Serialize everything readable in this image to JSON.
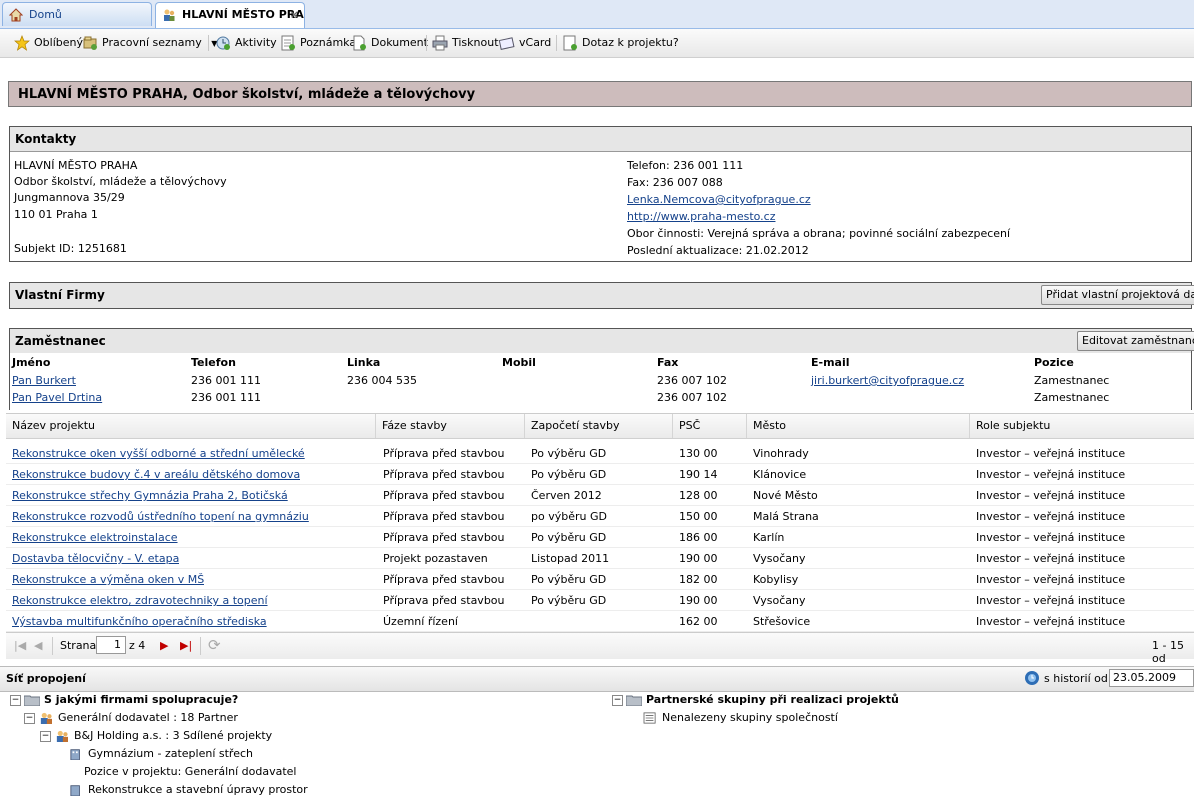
{
  "tabs": [
    {
      "label": "Domů",
      "icon": "home-icon"
    },
    {
      "label": "HLAVNÍ MĚSTO PRA",
      "icon": "people-icon",
      "close": "×"
    }
  ],
  "toolbar": {
    "oblibeny": "Oblíbený",
    "pracovni": "Pracovní seznamy",
    "aktivity": "Aktivity",
    "poznamka": "Poznámka",
    "dokument": "Dokument",
    "tisknout": "Tisknout",
    "vcard": "vCard",
    "dotaz": "Dotaz k projektu?"
  },
  "title": "HLAVNÍ MĚSTO PRAHA, Odbor školství, mládeže a tělovýchovy",
  "kontakty": {
    "header": "Kontakty",
    "name": "HLAVNÍ MĚSTO PRAHA",
    "dept": "Odbor školství, mládeže a tělovýchovy",
    "street": "Jungmannova 35/29",
    "city": "110 01 Praha 1",
    "subject_id": "Subjekt ID: 1251681",
    "phone": "Telefon: 236 001 111",
    "fax": "Fax: 236 007 088",
    "email": "Lenka.Nemcova@cityofprague.cz",
    "web": "http://www.praha-mesto.cz",
    "obor": "Obor činnosti: Verejná správa a obrana; povinné sociální zabezpecení",
    "aktualizace": "Poslední aktualizace: 21.02.2012"
  },
  "firmy": {
    "header": "Vlastní Firmy",
    "button": "Přidat vlastní projektová data"
  },
  "zamestnanec": {
    "header": "Zaměstnanec",
    "button": "Editovat zaměstnance",
    "columns": [
      "Jméno",
      "Telefon",
      "Linka",
      "Mobil",
      "Fax",
      "E-mail",
      "Pozice"
    ],
    "rows": [
      {
        "name": "Pan Burkert",
        "phone": "236 001 111",
        "linka": "236 004 535",
        "mobil": "",
        "fax": "236 007 102",
        "email": "jiri.burkert@cityofprague.cz",
        "pozice": "Zamestnanec"
      },
      {
        "name": "Pan Pavel Drtina",
        "phone": "236 001 111",
        "linka": "",
        "mobil": "",
        "fax": "236 007 102",
        "email": "",
        "pozice": "Zamestnanec"
      }
    ]
  },
  "projects": {
    "columns": [
      "Název projektu",
      "Fáze stavby",
      "Započetí stavby",
      "PSČ",
      "Město",
      "Role subjektu"
    ],
    "rows": [
      {
        "name": "Rekonstrukce oken vyšší odborné a střední umělecké",
        "faze": "Příprava před stavbou",
        "zapoceti": "Po výběru GD",
        "psc": "130 00",
        "mesto": "Vinohrady",
        "role": "Investor – veřejná instituce"
      },
      {
        "name": "Rekonstrukce budovy č.4 v areálu dětského domova",
        "faze": "Příprava před stavbou",
        "zapoceti": "Po výběru GD",
        "psc": "190 14",
        "mesto": "Klánovice",
        "role": "Investor – veřejná instituce"
      },
      {
        "name": "Rekonstrukce střechy Gymnázia Praha 2, Botičská",
        "faze": "Příprava před stavbou",
        "zapoceti": "Červen 2012",
        "psc": "128 00",
        "mesto": "Nové Město",
        "role": "Investor – veřejná instituce"
      },
      {
        "name": "Rekonstrukce rozvodů ústředního topení na gymnáziu",
        "faze": "Příprava před stavbou",
        "zapoceti": "po výběru GD",
        "psc": "150 00",
        "mesto": "Malá Strana",
        "role": "Investor – veřejná instituce"
      },
      {
        "name": "Rekonstrukce elektroinstalace",
        "faze": "Příprava před stavbou",
        "zapoceti": "Po výběru GD",
        "psc": "186 00",
        "mesto": "Karlín",
        "role": "Investor – veřejná instituce"
      },
      {
        "name": "Dostavba tělocvičny - V. etapa",
        "faze": "Projekt pozastaven",
        "zapoceti": "Listopad 2011",
        "psc": "190 00",
        "mesto": "Vysočany",
        "role": "Investor – veřejná instituce"
      },
      {
        "name": "Rekonstrukce a výměna oken v MŠ",
        "faze": "Příprava před stavbou",
        "zapoceti": "Po výběru GD",
        "psc": "182 00",
        "mesto": "Kobylisy",
        "role": "Investor – veřejná instituce"
      },
      {
        "name": "Rekonstrukce elektro, zdravotechniky a topení",
        "faze": "Příprava před stavbou",
        "zapoceti": "Po výběru GD",
        "psc": "190 00",
        "mesto": "Vysočany",
        "role": "Investor – veřejná instituce"
      },
      {
        "name": "Výstavba multifunkčního operačního střediska",
        "faze": "Územní řízení",
        "zapoceti": "",
        "psc": "162 00",
        "mesto": "Střešovice",
        "role": "Investor – veřejná instituce"
      }
    ]
  },
  "pager": {
    "label": "Strana",
    "page": "1",
    "of": "z 4",
    "summary": "1 - 15 od"
  },
  "sit": {
    "header": "Síť propojení",
    "history_label": "s historií od::",
    "history_date": "23.05.2009",
    "tree_left": [
      {
        "text": "S jakými firmami spolupracuje?",
        "bold": true
      },
      {
        "text": "Generální dodavatel : 18 Partner"
      },
      {
        "text": "B&J Holding a.s. : 3 Sdílené projekty"
      },
      {
        "text": "Gymnázium - zateplení střech"
      },
      {
        "text": "Pozice v projektu: Generální dodavatel"
      },
      {
        "text": "Rekonstrukce a stavební úpravy prostor"
      }
    ],
    "tree_right": [
      {
        "text": "Partnerské skupiny při realizaci projektů",
        "bold": true
      },
      {
        "text": "Nenalezeny skupiny společností"
      }
    ]
  }
}
